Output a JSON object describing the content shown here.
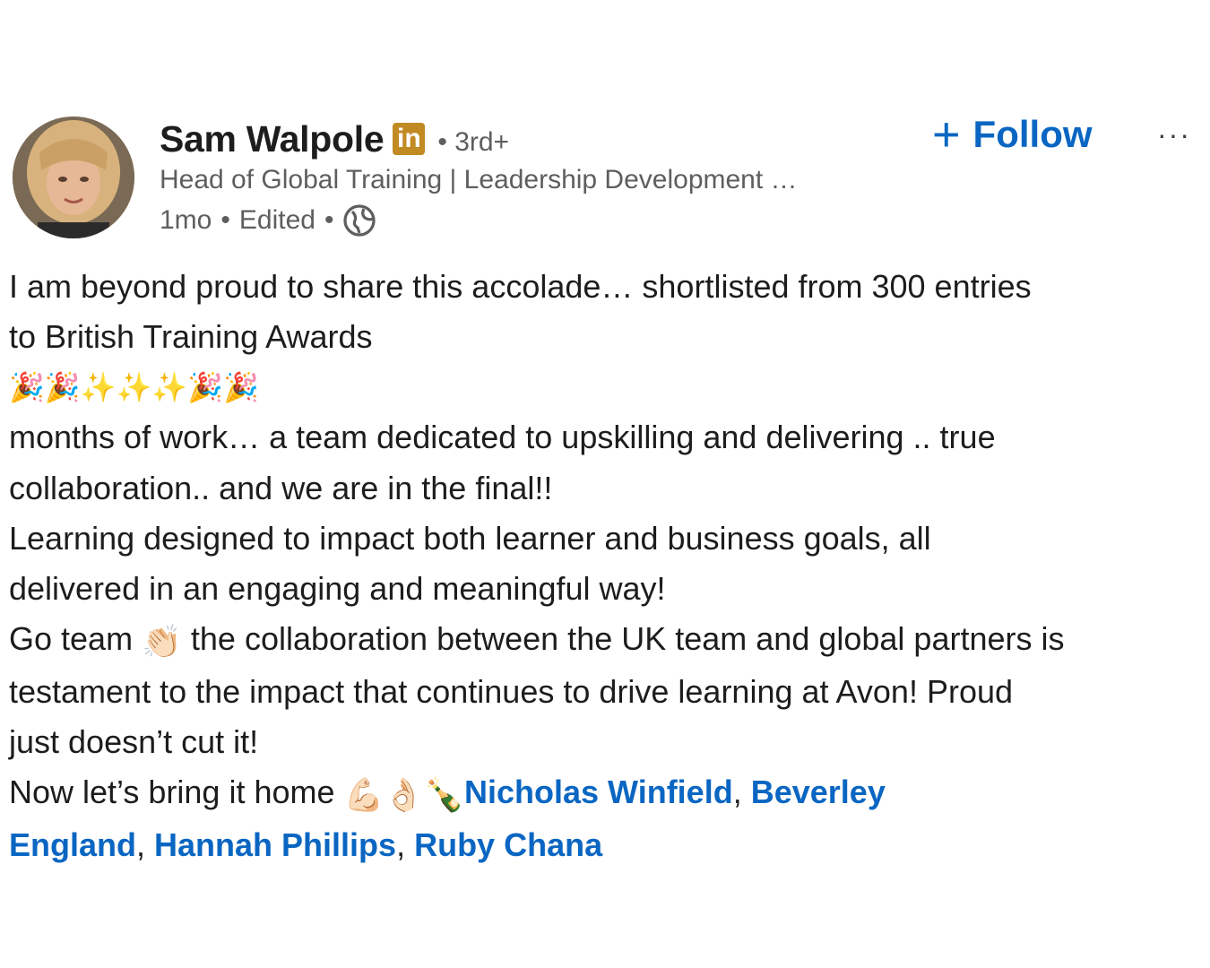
{
  "actor": {
    "name": "Sam Walpole",
    "badge_icon": "linkedin-premium-icon",
    "badge_text": "in",
    "degree": "• 3rd+",
    "headline": "Head of Global Training | Leadership Development …",
    "time": "1mo",
    "sep1": "•",
    "edited": "Edited",
    "sep2": "•",
    "visibility_icon": "globe-icon"
  },
  "actions": {
    "follow_plus": "+",
    "follow_label": "Follow",
    "more_label": "···"
  },
  "post": {
    "line1": "I am beyond proud to share this accolade… shortlisted from 300 entries",
    "line2": "to British Training Awards",
    "emoji_line": "🎉🎉✨✨✨🎉🎉",
    "line3": "months of work… a team dedicated to upskilling and delivering .. true",
    "line4": "collaboration.. and we are in the final!!",
    "line5": "Learning designed to impact both learner and business goals, all",
    "line6": "delivered in an engaging and meaningful way!",
    "line7_a": "Go team ",
    "line7_emoji": "👏🏻",
    "line7_b": " the collaboration between the UK team and global partners is",
    "line8": "testament to the impact that continues to drive learning at Avon! Proud",
    "line9": "just doesn’t cut it!",
    "line10_a": "Now let’s bring it home ",
    "line10_emoji": "💪🏻👌🏻🍾",
    "mentions": [
      "Nicholas Winfield",
      "Beverley England",
      "Hannah Phillips",
      "Ruby Chana"
    ],
    "mention_1": "Nicholas Winfield",
    "comma_1": ", ",
    "mention_2_part1": "Beverley",
    "mention_2_part2": "England",
    "comma_2": ", ",
    "mention_3": "Hannah Phillips",
    "comma_3": ", ",
    "mention_4": "Ruby Chana"
  },
  "colors": {
    "link": "#0a66c2",
    "text": "#1d1d1d",
    "secondary": "#5e5e5e",
    "badge": "#c28a23"
  }
}
